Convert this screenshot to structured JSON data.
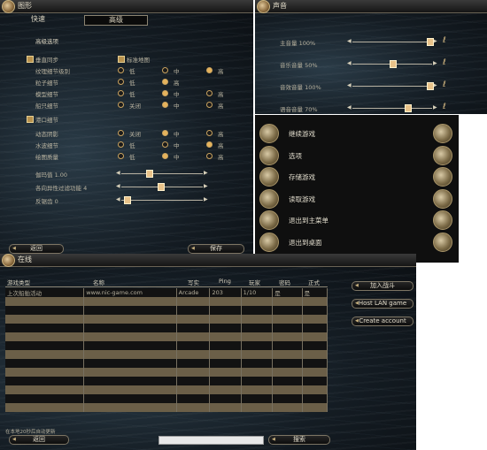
{
  "graphics": {
    "title": "图形",
    "tabs": [
      "快速",
      "高级"
    ],
    "section_title": "高级选项",
    "vsync_label": "垂直同步",
    "std_map_label": "标准地图",
    "rows": [
      {
        "label": "纹理细节级别",
        "opts": [
          "低",
          "中",
          "高"
        ],
        "sel": 2
      },
      {
        "label": "粒子细节",
        "opts": [
          "低",
          "高"
        ],
        "sel": 1
      },
      {
        "label": "模型细节",
        "opts": [
          "低",
          "中",
          "高"
        ],
        "sel": 1
      },
      {
        "label": "船只细节",
        "opts": [
          "关闭",
          "中",
          "高"
        ],
        "sel": 1
      }
    ],
    "port_detail_label": "港口细节",
    "rows2": [
      {
        "label": "动态阴影",
        "opts": [
          "关闭",
          "中",
          "高"
        ],
        "sel": 1
      },
      {
        "label": "水波细节",
        "opts": [
          "低",
          "中",
          "高"
        ],
        "sel": 2
      },
      {
        "label": "绘图质量",
        "opts": [
          "低",
          "中",
          "高"
        ],
        "sel": 1
      }
    ],
    "sliders": [
      {
        "label": "伽玛值 1.00",
        "value": 0.33
      },
      {
        "label": "各向异性过滤功能 4",
        "value": 0.48
      },
      {
        "label": "反锯齿 0",
        "value": 0.03
      }
    ],
    "back": "返回",
    "save": "保存"
  },
  "sound": {
    "title": "声音",
    "sliders": [
      {
        "label": "主音量 100%",
        "value": 1.0
      },
      {
        "label": "音乐音量 50%",
        "value": 0.5
      },
      {
        "label": "音效音量 100%",
        "value": 1.0
      },
      {
        "label": "语音音量 70%",
        "value": 0.7
      }
    ]
  },
  "menu": {
    "items": [
      "继续游戏",
      "选项",
      "存储游戏",
      "读取游戏",
      "退出到主菜单",
      "退出到桌面"
    ]
  },
  "online": {
    "title": "在线",
    "columns": [
      "游戏类型",
      "名称",
      "写实",
      "Ping",
      "玩家",
      "密码",
      "正式"
    ],
    "rows": [
      [
        "上次船舶活动",
        "www.nic-game.com",
        "Arcade",
        "203",
        "1/10",
        "是",
        "是"
      ]
    ],
    "join": "加入战斗",
    "host": "Host LAN game",
    "create": "Create account",
    "auto_refresh": "在本地20秒后自动更新",
    "back": "返回",
    "search": "搜索"
  }
}
